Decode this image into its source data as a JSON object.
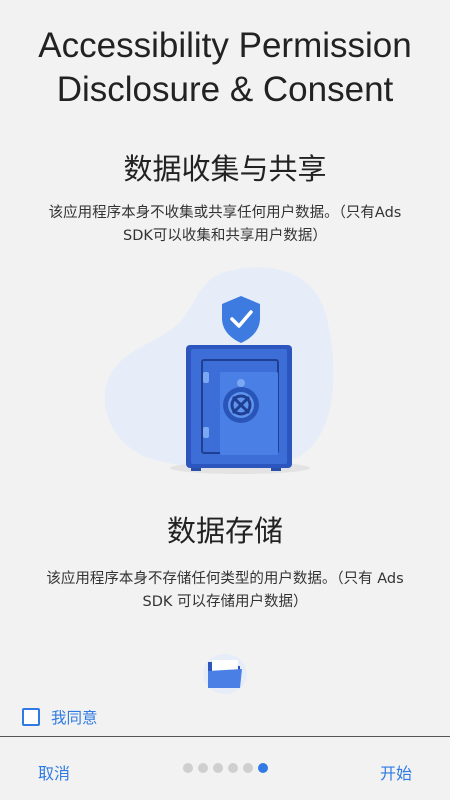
{
  "header": {
    "title_line1": "Accessibility Permission",
    "title_line2": "Disclosure & Consent"
  },
  "sections": [
    {
      "heading": "数据收集与共享",
      "text": "该应用程序本身不收集或共享任何用户数据。（只有Ads SDK可以收集和共享用户数据）"
    },
    {
      "heading": "数据存储",
      "text": "该应用程序本身不存储任何类型的用户数据。（只有 Ads SDK 可以存储用户数据）"
    }
  ],
  "illustrations": {
    "section1_icon": "shield-safe-icon",
    "section2_icon": "folder-icon"
  },
  "consent": {
    "label": "我同意",
    "checked": false
  },
  "footer": {
    "cancel_label": "取消",
    "start_label": "开始",
    "page_count": 6,
    "current_page": 6
  },
  "colors": {
    "accent": "#2f7be3",
    "background": "#f2f2f2",
    "safe_blue": "#3d6ed8",
    "blob": "#e6edf8"
  }
}
